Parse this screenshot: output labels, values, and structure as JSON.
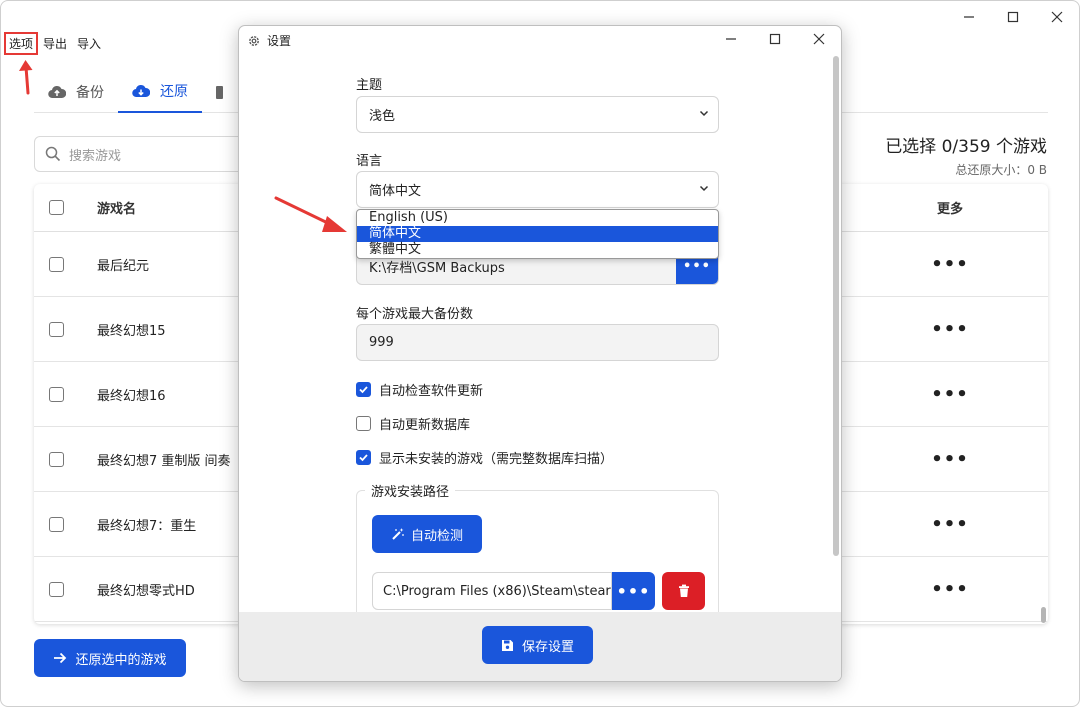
{
  "menu": {
    "options": "选项",
    "export": "导出",
    "import": "导入"
  },
  "tabs": [
    {
      "label": "备份"
    },
    {
      "label": "还原"
    }
  ],
  "search": {
    "placeholder": "搜索游戏"
  },
  "summary": {
    "selected": "已选择 0/359 个游戏",
    "total_size": "总还原大小：0 B"
  },
  "table": {
    "header_name": "游戏名",
    "header_more": "更多",
    "rows": [
      "最后纪元",
      "最终幻想15",
      "最终幻想16",
      "最终幻想7 重制版 间奏",
      "最终幻想7：重生",
      "最终幻想零式HD"
    ],
    "more_symbol": "•••"
  },
  "restore_button": "还原选中的游戏",
  "settings": {
    "title": "设置",
    "theme_label": "主题",
    "theme_value": "浅色",
    "language_label": "语言",
    "language_value": "简体中文",
    "language_options": [
      "English (US)",
      "简体中文",
      "繁體中文"
    ],
    "language_selected_index": 1,
    "backup_path": "K:\\存档\\GSM Backups",
    "browse_symbol": "•••",
    "max_backups_label": "每个游戏最大备份数",
    "max_backups_value": "999",
    "checkboxes": [
      {
        "label": "自动检查软件更新",
        "checked": true
      },
      {
        "label": "自动更新数据库",
        "checked": false
      },
      {
        "label": "显示未安装的游戏（需完整数据库扫描）",
        "checked": true
      }
    ],
    "install_paths_label": "游戏安装路径",
    "auto_detect_button": "自动检测",
    "install_path_value": "C:\\Program Files (x86)\\Steam\\stear",
    "save_button": "保存设置"
  },
  "colors": {
    "accent": "#1a56db",
    "danger": "#dc1f26",
    "annotation": "#e53935"
  }
}
